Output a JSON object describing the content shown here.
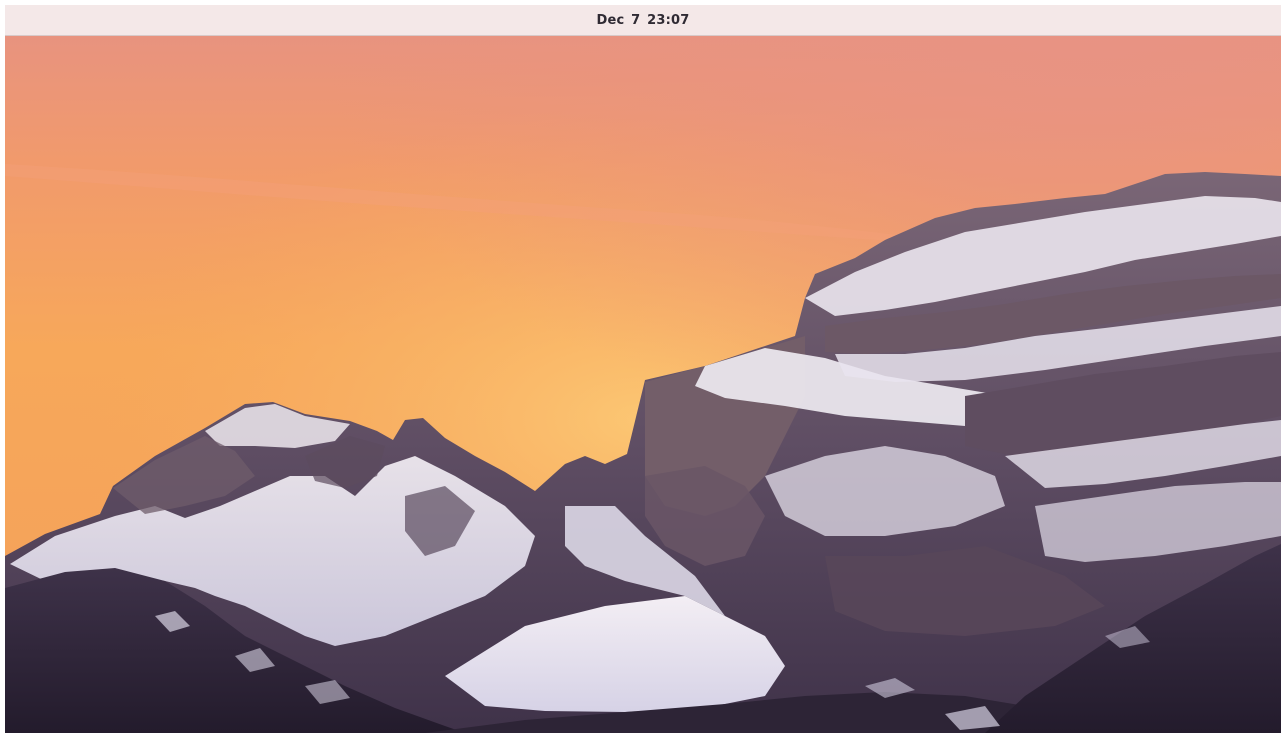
{
  "top_bar": {
    "clock": "Dec 7  23:07"
  },
  "desktop": {
    "wallpaper": "snowy-mountains-sunset",
    "colors": {
      "sky_top": "#e99a82",
      "sky_mid": "#f7a35c",
      "sky_glow": "#fbc670",
      "rock": "#6b5a6e",
      "rock_dark": "#3a2e45",
      "snow": "#ece8f2",
      "topbar": "#f4e8e8"
    }
  }
}
